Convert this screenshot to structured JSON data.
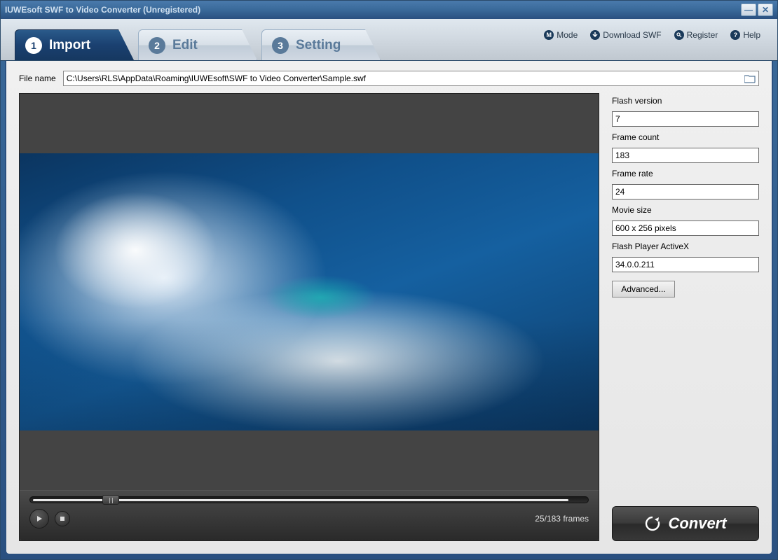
{
  "window": {
    "title": "IUWEsoft SWF to Video Converter (Unregistered)"
  },
  "tabs": [
    {
      "num": "1",
      "label": "Import",
      "active": true
    },
    {
      "num": "2",
      "label": "Edit",
      "active": false
    },
    {
      "num": "3",
      "label": "Setting",
      "active": false
    }
  ],
  "toolbar": {
    "mode": "Mode",
    "download": "Download SWF",
    "register": "Register",
    "help": "Help"
  },
  "file": {
    "label": "File name",
    "path": "C:\\Users\\RLS\\AppData\\Roaming\\IUWEsoft\\SWF to Video Converter\\Sample.swf"
  },
  "info": {
    "flash_version_label": "Flash version",
    "flash_version": "7",
    "frame_count_label": "Frame count",
    "frame_count": "183",
    "frame_rate_label": "Frame rate",
    "frame_rate": "24",
    "movie_size_label": "Movie size",
    "movie_size": "600 x 256 pixels",
    "activex_label": "Flash Player ActiveX",
    "activex": "34.0.0.211",
    "advanced": "Advanced..."
  },
  "player": {
    "cur_frame": "25",
    "total_frames": "183",
    "frames_word": "frames",
    "position_pct": 13
  },
  "convert": {
    "label": "Convert"
  }
}
